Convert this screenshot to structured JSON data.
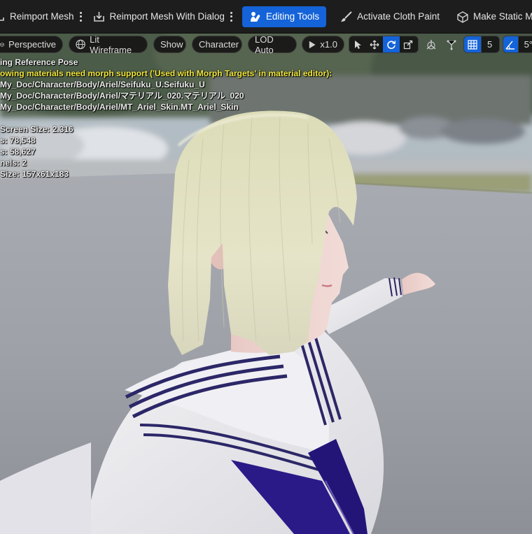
{
  "toolbar": {
    "reimport_mesh": "Reimport Mesh",
    "reimport_with_dialog": "Reimport Mesh With Dialog",
    "editing_tools": "Editing Tools",
    "activate_cloth_paint": "Activate Cloth Paint",
    "make_static_mesh": "Make Static Mesh"
  },
  "viewport_bar": {
    "perspective": "Perspective",
    "lit_wireframe": "Lit Wireframe",
    "show": "Show",
    "character": "Character",
    "lod": "LOD Auto",
    "play_speed": "x1.0",
    "grid_size": "5",
    "angle_snap": "5°"
  },
  "overlay": {
    "line1": "ing Reference Pose",
    "line2": "owing materials need morph support ('Used with Morph Targets' in material editor):",
    "line3": "My_Doc/Character/Body/Ariel/Seifuku_U.Seifuku_U",
    "line4": "My_Doc/Character/Body/Ariel/マテリアル_020.マテリアル_020",
    "line5": "My_Doc/Character/Body/Ariel/MT_Ariel_Skin.MT_Ariel_Skin",
    "line6": "Screen Size: 2.316",
    "line7": "s: 78,548",
    "line8": "s: 58,627",
    "line9": "nels: 2",
    "line10": "Size: 157x61x183"
  },
  "colors": {
    "active_blue": "#1463d8",
    "warning_yellow": "#f0e63c",
    "toolbar_bg": "#1d1d1d"
  },
  "icons": {
    "reimport": "reimport-mesh-icon",
    "reimport_dialog": "reimport-dialog-icon",
    "editing_tools": "editing-tools-icon",
    "cloth_paint": "brush-icon",
    "static_mesh": "static-mesh-icon",
    "perspective": "cube-icon",
    "view_mode": "sphere-wireframe-icon",
    "play": "play-icon",
    "select": "select-arrow-icon",
    "translate": "translate-icon",
    "rotate": "rotate-icon",
    "scale": "scale-icon",
    "local": "local-space-icon",
    "world": "world-space-icon",
    "grid": "grid-snap-icon",
    "angle": "angle-snap-icon"
  }
}
